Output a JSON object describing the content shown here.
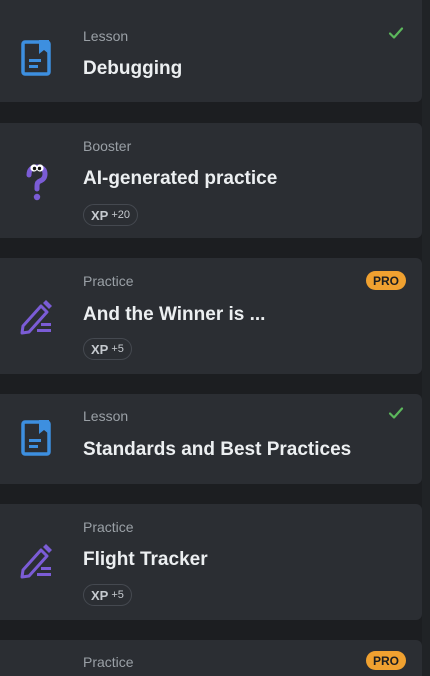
{
  "cards": [
    {
      "type": "Lesson",
      "title": "Debugging",
      "kind": "lesson",
      "completed": true
    },
    {
      "type": "Booster",
      "title": "AI-generated practice",
      "kind": "booster",
      "xp_label": "XP",
      "xp_value": "+20"
    },
    {
      "type": "Practice",
      "title": "And the Winner is ...",
      "kind": "practice",
      "pro": "PRO",
      "xp_label": "XP",
      "xp_value": "+5"
    },
    {
      "type": "Lesson",
      "title": "Standards and Best Practices",
      "kind": "lesson",
      "completed": true
    },
    {
      "type": "Practice",
      "title": "Flight Tracker",
      "kind": "practice",
      "xp_label": "XP",
      "xp_value": "+5"
    },
    {
      "type": "Practice",
      "title": "",
      "kind": "practice",
      "pro": "PRO"
    }
  ],
  "colors": {
    "lesson_icon": "#3d8fe0",
    "practice_icon": "#7b5cd6",
    "booster_icon": "#7b5cd6",
    "check": "#5cb85c",
    "pro_badge": "#f0a130"
  }
}
